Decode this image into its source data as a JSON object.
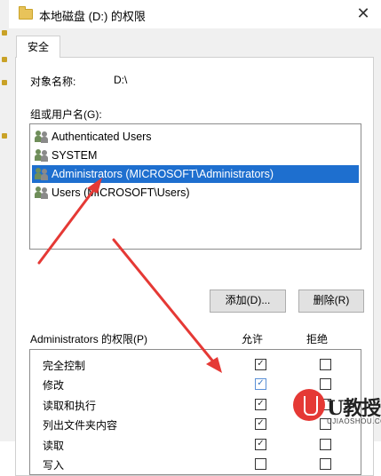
{
  "window": {
    "title": "本地磁盘 (D:) 的权限",
    "close_glyph": "✕"
  },
  "tabs": [
    {
      "label": "安全"
    }
  ],
  "object": {
    "label": "对象名称:",
    "value": "D:\\"
  },
  "groups": {
    "label": "组或用户名(G):",
    "users": [
      {
        "name": "Authenticated Users",
        "selected": false
      },
      {
        "name": "SYSTEM",
        "selected": false
      },
      {
        "name": "Administrators (MICROSOFT\\Administrators)",
        "selected": true
      },
      {
        "name": "Users (MICROSOFT\\Users)",
        "selected": false
      }
    ]
  },
  "buttons": {
    "add": "添加(D)...",
    "remove": "删除(R)"
  },
  "permissions": {
    "title": "Administrators 的权限(P)",
    "allow_header": "允许",
    "deny_header": "拒绝",
    "rows": [
      {
        "name": "完全控制",
        "allow": true,
        "deny": false
      },
      {
        "name": "修改",
        "allow": true,
        "deny": false
      },
      {
        "name": "读取和执行",
        "allow": true,
        "deny": false
      },
      {
        "name": "列出文件夹内容",
        "allow": true,
        "deny": false
      },
      {
        "name": "读取",
        "allow": true,
        "deny": false
      },
      {
        "name": "写入",
        "allow": false,
        "deny": false
      }
    ]
  },
  "watermark": {
    "brand": "U教授",
    "url": "UJIAOSHOU.COM",
    "accent": "#e53935"
  },
  "colors": {
    "selection": "#1e6fcf",
    "arrow": "#e53935"
  }
}
